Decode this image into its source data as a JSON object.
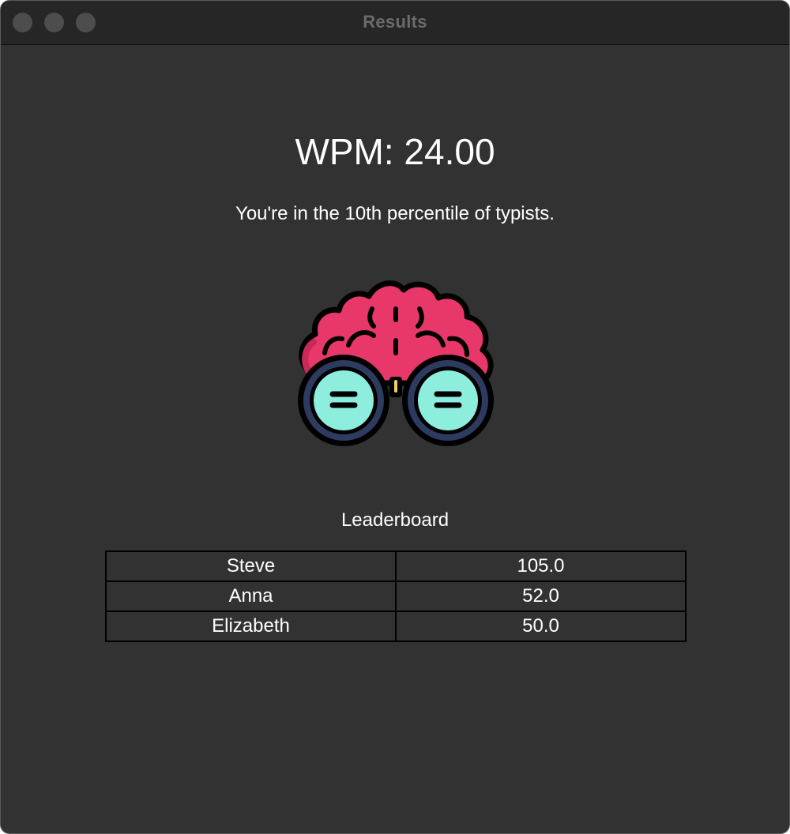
{
  "window": {
    "title": "Results"
  },
  "results": {
    "wpm": "WPM: 24.00",
    "percentile": "You're in the 10th percentile of typists.",
    "icon": "nerd-brain-glasses-icon"
  },
  "leaderboard": {
    "title": "Leaderboard",
    "rows": [
      {
        "name": "Steve",
        "score": "105.0"
      },
      {
        "name": "Anna",
        "score": "52.0"
      },
      {
        "name": "Elizabeth",
        "score": "50.0"
      }
    ]
  },
  "colors": {
    "background": "#323232",
    "brain": "#e8386a",
    "lens": "#8eeedd",
    "frame": "#2d3b60"
  }
}
